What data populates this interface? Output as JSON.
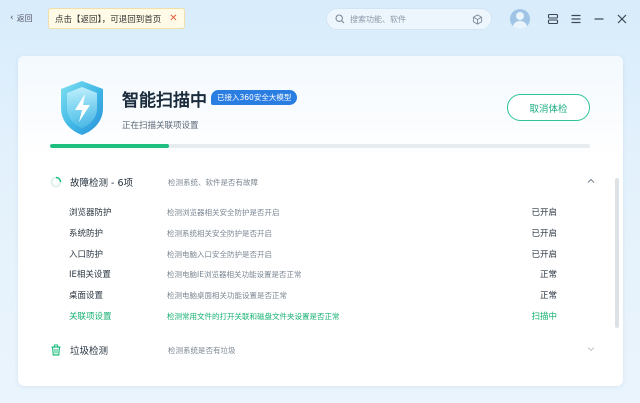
{
  "titlebar": {
    "back_label": "返回",
    "tooltip_text": "点击【返回】，可退回到首页",
    "search_placeholder": "搜索功能、软件"
  },
  "hero": {
    "title": "智能扫描中",
    "badge": "已接入360安全大模型",
    "subtitle": "正在扫描关联项设置",
    "cancel_label": "取消体检",
    "progress_fraction": 0.22
  },
  "fault_section": {
    "title": "故障检测 - 6项",
    "description": "检测系统、软件是否有故障",
    "items": [
      {
        "name": "浏览器防护",
        "desc": "检测浏览器相关安全防护是否开启",
        "status": "已开启",
        "active": false
      },
      {
        "name": "系统防护",
        "desc": "检测系统相关安全防护是否开启",
        "status": "已开启",
        "active": false
      },
      {
        "name": "入口防护",
        "desc": "检测电脑入口安全防护是否开启",
        "status": "已开启",
        "active": false
      },
      {
        "name": "IE相关设置",
        "desc": "检测电脑IE浏览器相关功能设置是否正常",
        "status": "正常",
        "active": false
      },
      {
        "name": "桌面设置",
        "desc": "检测电脑桌面相关功能设置是否正常",
        "status": "正常",
        "active": false
      },
      {
        "name": "关联项设置",
        "desc": "检测常用文件的打开关联和磁盘文件夹设置是否正常",
        "status": "扫描中",
        "active": true
      }
    ]
  },
  "junk_section": {
    "title": "垃圾检测",
    "description": "检测系统是否有垃圾"
  },
  "colors": {
    "accent_green": "#1fbf7f",
    "badge_blue": "#2a7de1",
    "cancel_border": "#2fc39a"
  }
}
